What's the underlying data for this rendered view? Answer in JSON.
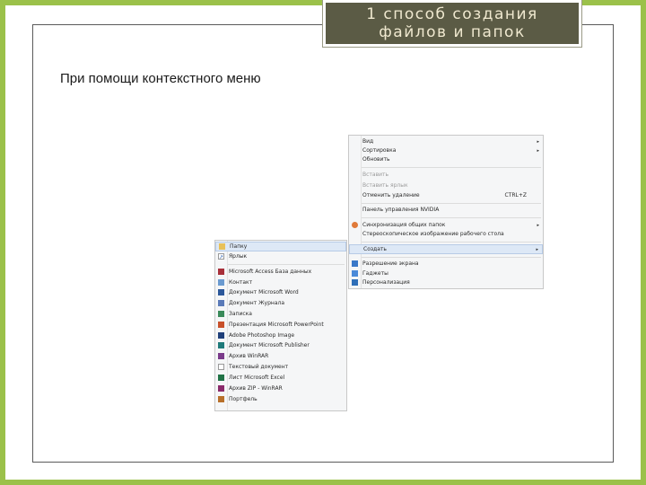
{
  "slide": {
    "title_line1": "1 способ создания",
    "title_line2": "файлов и папок",
    "subtitle": "При помощи контекстного меню"
  },
  "context_menu": {
    "items": [
      {
        "label": "Вид",
        "arrow": "▸"
      },
      {
        "label": "Сортировка",
        "arrow": "▸"
      },
      {
        "label": "Обновить"
      },
      {
        "label": "Вставить",
        "disabled": true
      },
      {
        "label": "Вставить ярлык",
        "disabled": true
      },
      {
        "label": "Отменить удаление",
        "shortcut": "CTRL+Z"
      },
      {
        "label": "Панель управления NVIDIA"
      },
      {
        "label": "Синхронизация общих папок",
        "arrow": "▸"
      },
      {
        "label": "Стереоскопическое изображение рабочего стола"
      },
      {
        "label": "Создать",
        "arrow": "▸"
      },
      {
        "label": "Разрешение экрана"
      },
      {
        "label": "Гаджеты"
      },
      {
        "label": "Персонализация"
      }
    ]
  },
  "new_submenu": {
    "items": [
      {
        "label": "Папку"
      },
      {
        "label": "Ярлык"
      },
      {
        "label": "Microsoft Access База данных"
      },
      {
        "label": "Контакт"
      },
      {
        "label": "Документ Microsoft Word"
      },
      {
        "label": "Документ Журнала"
      },
      {
        "label": "Записка"
      },
      {
        "label": "Презентация Microsoft PowerPoint"
      },
      {
        "label": "Adobe Photoshop Image"
      },
      {
        "label": "Документ Microsoft Publisher"
      },
      {
        "label": "Архив WinRAR"
      },
      {
        "label": "Текстовый документ"
      },
      {
        "label": "Лист Microsoft Excel"
      },
      {
        "label": "Архив ZIP - WinRAR"
      },
      {
        "label": "Портфель"
      }
    ]
  },
  "colors": {
    "frame_green": "#9bc14a",
    "title_bg": "#5b5b45",
    "title_text": "#efe8cf",
    "menu_bg": "#f5f6f7",
    "menu_hover": "#dde8f6"
  }
}
